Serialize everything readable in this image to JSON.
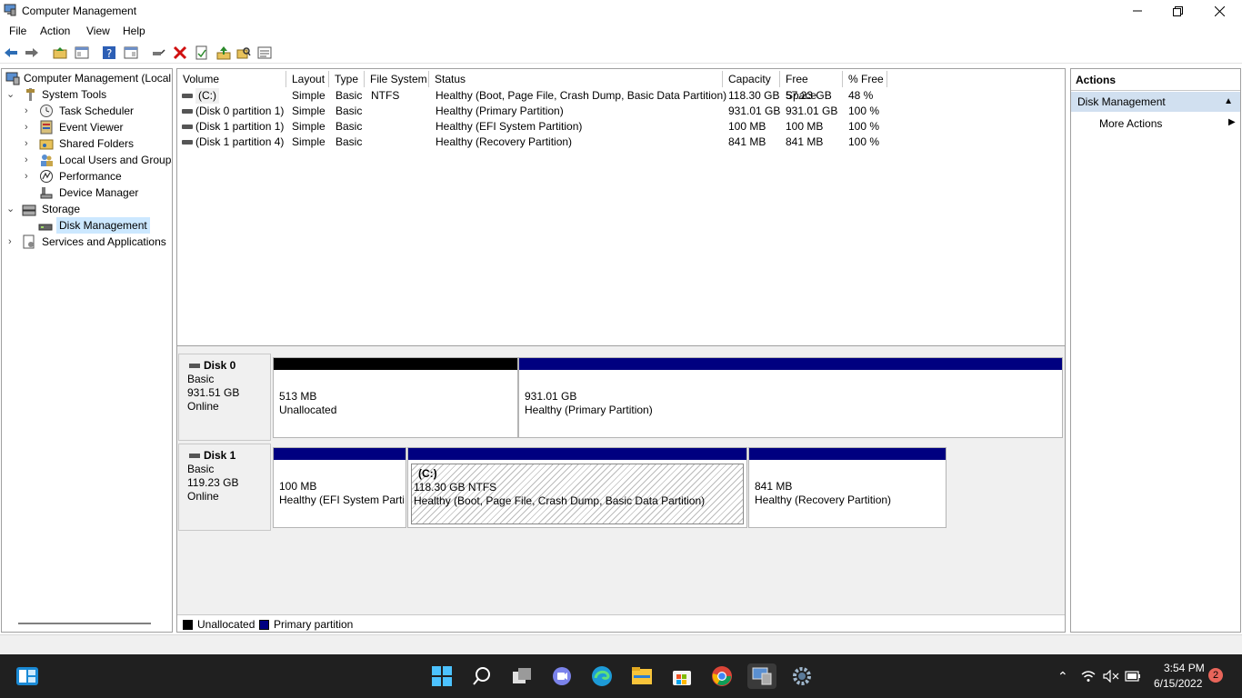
{
  "window": {
    "title": "Computer Management"
  },
  "menu": [
    "File",
    "Action",
    "View",
    "Help"
  ],
  "tree": {
    "root": "Computer Management (Local",
    "system_tools": "System Tools",
    "task_scheduler": "Task Scheduler",
    "event_viewer": "Event Viewer",
    "shared_folders": "Shared Folders",
    "local_users": "Local Users and Groups",
    "performance": "Performance",
    "device_manager": "Device Manager",
    "storage": "Storage",
    "disk_management": "Disk Management",
    "services": "Services and Applications"
  },
  "table": {
    "headers": [
      "Volume",
      "Layout",
      "Type",
      "File System",
      "Status",
      "Capacity",
      "Free Space",
      "% Free"
    ],
    "rows": [
      [
        "(C:)",
        "Simple",
        "Basic",
        "NTFS",
        "Healthy (Boot, Page File, Crash Dump, Basic Data Partition)",
        "118.30 GB",
        "57.23 GB",
        "48 %"
      ],
      [
        "(Disk 0 partition 1)",
        "Simple",
        "Basic",
        "",
        "Healthy (Primary Partition)",
        "931.01 GB",
        "931.01 GB",
        "100 %"
      ],
      [
        "(Disk 1 partition 1)",
        "Simple",
        "Basic",
        "",
        "Healthy (EFI System Partition)",
        "100 MB",
        "100 MB",
        "100 %"
      ],
      [
        "(Disk 1 partition 4)",
        "Simple",
        "Basic",
        "",
        "Healthy (Recovery Partition)",
        "841 MB",
        "841 MB",
        "100 %"
      ]
    ]
  },
  "disks": [
    {
      "name": "Disk 0",
      "type": "Basic",
      "size": "931.51 GB",
      "state": "Online",
      "partitions": [
        {
          "size": "513 MB",
          "status": "Unallocated"
        },
        {
          "size": "931.01 GB",
          "status": "Healthy (Primary Partition)"
        }
      ]
    },
    {
      "name": "Disk 1",
      "type": "Basic",
      "size": "119.23 GB",
      "state": "Online",
      "partitions": [
        {
          "size": "100 MB",
          "status": "Healthy (EFI System Parti"
        },
        {
          "label": "(C:)",
          "size": "118.30 GB NTFS",
          "status": "Healthy (Boot, Page File, Crash Dump, Basic Data Partition)"
        },
        {
          "size": "841 MB",
          "status": "Healthy (Recovery Partition)"
        }
      ]
    }
  ],
  "legend": {
    "unallocated": "Unallocated",
    "primary": "Primary partition"
  },
  "colors": {
    "unallocated": "#000000",
    "primary": "#000080",
    "selection": "#cce8ff",
    "actions_header": "#d1e0f0"
  },
  "actions": {
    "title": "Actions",
    "section": "Disk Management",
    "more": "More Actions"
  },
  "taskbar": {
    "time": "3:54 PM",
    "date": "6/15/2022",
    "notifications": "2"
  }
}
